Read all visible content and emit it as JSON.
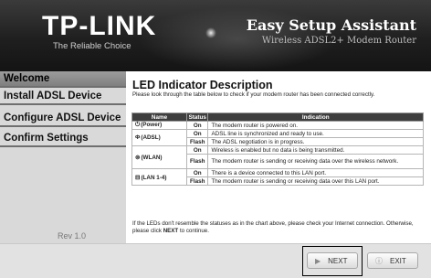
{
  "header": {
    "brand": "TP-LINK",
    "tagline": "The Reliable Choice",
    "title": "Easy Setup Assistant",
    "subtitle": "Wireless ADSL2+ Modem Router"
  },
  "sidebar": {
    "items": [
      {
        "label": "Welcome"
      },
      {
        "label": "Install ADSL Device"
      },
      {
        "label": "Configure ADSL Device"
      },
      {
        "label": "Confirm Settings"
      }
    ],
    "active_index": 0,
    "revision": "Rev 1.0"
  },
  "content": {
    "title": "LED Indicator Description",
    "description": "Please look through the table below to check if your modem router has been connected correctly.",
    "table": {
      "headers": [
        "Name",
        "Status",
        "Indication"
      ],
      "rows": [
        {
          "name": "(Power)",
          "icon": "power-icon",
          "status": "On",
          "indication": "The modem router is powered on."
        },
        {
          "name": "(ADSL)",
          "icon": "adsl-icon",
          "status": "On",
          "indication": "ADSL line is synchronized and ready to use."
        },
        {
          "name": "",
          "status": "Flash",
          "indication": "The ADSL negotiation is in progress."
        },
        {
          "name": "(WLAN)",
          "icon": "wlan-icon",
          "status": "On",
          "indication": "Wireless is enabled but no data is being transmitted."
        },
        {
          "name": "",
          "status": "Flash",
          "indication": "The modem router is sending or receiving data over the wireless network."
        },
        {
          "name": "(LAN 1-4)",
          "icon": "lan-icon",
          "status": "On",
          "indication": "There is a device connected to this LAN port."
        },
        {
          "name": "",
          "status": "Flash",
          "indication": "The modem router is sending or receiving data over this LAN port."
        }
      ]
    },
    "footer_pre": "If the LEDs don't resemble the statuses as in the chart above, please check your Internet connection. Otherwise, please click ",
    "footer_bold": "NEXT",
    "footer_post": " to continue."
  },
  "buttons": {
    "next_label": "NEXT",
    "exit_label": "EXIT"
  },
  "colors": {
    "header_bg": "#1f1f1f",
    "sidebar_bg": "#d9d9d9",
    "table_header_bg": "#3e3e3e"
  }
}
